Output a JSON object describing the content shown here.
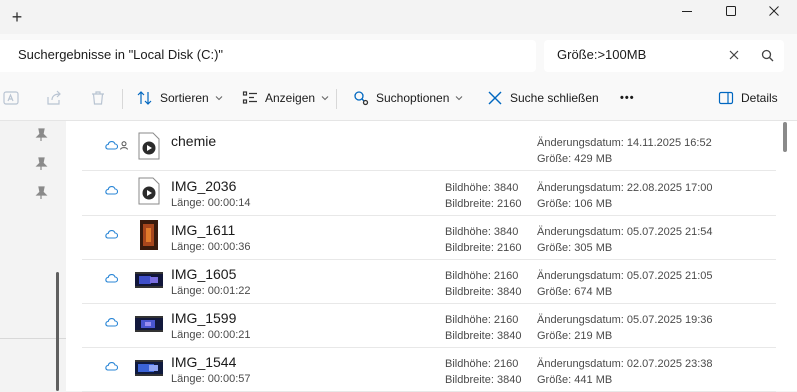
{
  "titlebar": {
    "new_tab": "+"
  },
  "address": {
    "path": "Suchergebnisse in \"Local Disk (C:)\""
  },
  "search": {
    "query": "Größe:>100MB"
  },
  "toolbar": {
    "sort_label": "Sortieren",
    "view_label": "Anzeigen",
    "search_options_label": "Suchoptionen",
    "close_search_label": "Suche schließen",
    "more_label": "•••",
    "details_label": "Details"
  },
  "files": [
    {
      "name": "chemie",
      "line1": "",
      "line2": "",
      "height": "",
      "width": "",
      "modified": "Änderungsdatum: 14.11.2025 16:52",
      "size": "Größe: 429 MB"
    },
    {
      "name": "IMG_2036",
      "line1": "Länge: 00:00:14",
      "height": "Bildhöhe: 3840",
      "width": "Bildbreite: 2160",
      "modified": "Änderungsdatum: 22.08.2025 17:00",
      "size": "Größe: 106 MB"
    },
    {
      "name": "IMG_1611",
      "line1": "Länge: 00:00:36",
      "height": "Bildhöhe: 3840",
      "width": "Bildbreite: 2160",
      "modified": "Änderungsdatum: 05.07.2025 21:54",
      "size": "Größe: 305 MB"
    },
    {
      "name": "IMG_1605",
      "line1": "Länge: 00:01:22",
      "height": "Bildhöhe: 2160",
      "width": "Bildbreite: 3840",
      "modified": "Änderungsdatum: 05.07.2025 21:05",
      "size": "Größe: 674 MB"
    },
    {
      "name": "IMG_1599",
      "line1": "Länge: 00:00:21",
      "height": "Bildhöhe: 2160",
      "width": "Bildbreite: 3840",
      "modified": "Änderungsdatum: 05.07.2025 19:36",
      "size": "Größe: 219 MB"
    },
    {
      "name": "IMG_1544",
      "line1": "Länge: 00:00:57",
      "height": "Bildhöhe: 2160",
      "width": "Bildbreite: 3840",
      "modified": "Änderungsdatum: 02.07.2025 23:38",
      "size": "Größe: 441 MB"
    }
  ],
  "colors": {
    "accent": "#0067c0",
    "cloud": "#2a86d6"
  }
}
